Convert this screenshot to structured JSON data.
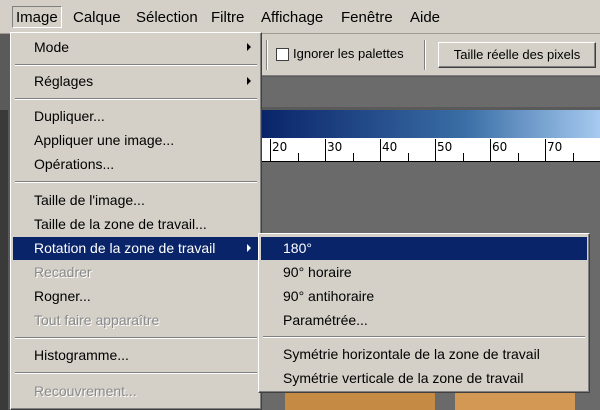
{
  "menubar": {
    "items": [
      {
        "label": "Image",
        "mnemonic": "I"
      },
      {
        "label": "Calque",
        "mnemonic": "C"
      },
      {
        "label": "Sélection",
        "mnemonic": "S"
      },
      {
        "label": "Filtre",
        "mnemonic": "F"
      },
      {
        "label": "Affichage",
        "mnemonic": "A"
      },
      {
        "label": "Fenêtre",
        "mnemonic": "n"
      },
      {
        "label": "Aide",
        "mnemonic": "d"
      }
    ]
  },
  "options_bar": {
    "ignore_palettes_label": "Ignorer les palettes",
    "ignore_palettes_checked": false,
    "actual_pixels_button": "Taille réelle des pixels"
  },
  "ruler": {
    "labels": [
      "20",
      "30",
      "40",
      "50",
      "60",
      "70"
    ]
  },
  "image_menu": {
    "items": [
      {
        "label": "Mode",
        "submenu": true,
        "enabled": true
      },
      {
        "label": "Réglages",
        "submenu": true,
        "enabled": true
      },
      {
        "label": "Dupliquer...",
        "enabled": true
      },
      {
        "label": "Appliquer une image...",
        "enabled": true
      },
      {
        "label": "Opérations...",
        "enabled": true
      },
      {
        "label": "Taille de l'image...",
        "enabled": true
      },
      {
        "label": "Taille de la zone de travail...",
        "enabled": true
      },
      {
        "label": "Rotation de la zone de travail",
        "submenu": true,
        "enabled": true,
        "selected": true
      },
      {
        "label": "Recadrer",
        "enabled": false
      },
      {
        "label": "Rogner...",
        "enabled": true
      },
      {
        "label": "Tout faire apparaître",
        "enabled": false
      },
      {
        "label": "Histogramme...",
        "enabled": true
      },
      {
        "label": "Recouvrement...",
        "enabled": false
      }
    ]
  },
  "rotation_submenu": {
    "items": [
      {
        "label": "180°",
        "selected": true
      },
      {
        "label": "90° horaire"
      },
      {
        "label": "90° antihoraire"
      },
      {
        "label": "Paramétrée..."
      },
      {
        "label": "Symétrie horizontale de la zone de travail"
      },
      {
        "label": "Symétrie verticale de la zone de travail"
      }
    ]
  },
  "colors": {
    "menu_bg": "#d4d0c8",
    "highlight": "#0a246a",
    "disabled_text": "#8a8a8a",
    "title_gradient_start": "#0a246a"
  }
}
